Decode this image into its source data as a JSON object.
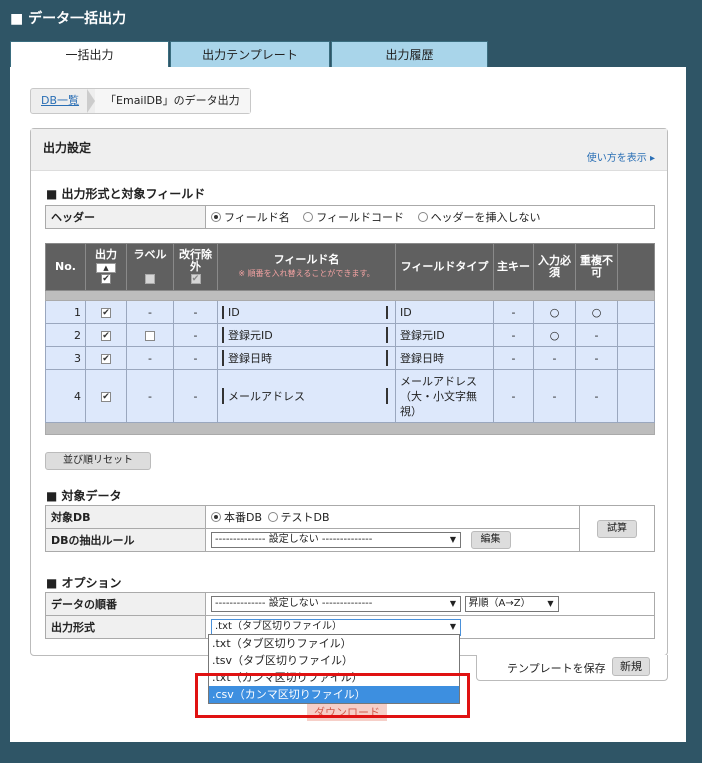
{
  "page_title": "■ データ一括出力",
  "tabs": [
    "一括出力",
    "出力テンプレート",
    "出力履歴"
  ],
  "breadcrumb": {
    "link": "DB一覧",
    "current": "「EmailDB」のデータ出力"
  },
  "panel": {
    "title": "出力設定",
    "help": "使い方を表示 ▸"
  },
  "section1": "■ 出力形式と対象フィールド",
  "header_row": {
    "label": "ヘッダー",
    "options": [
      "フィールド名",
      "フィールドコード",
      "ヘッダーを挿入しない"
    ],
    "selected": "フィールド名"
  },
  "field_table": {
    "headers": {
      "no": "No.",
      "output": "出力",
      "label": "ラベル",
      "newline": "改行除外",
      "field_name": "フィールド名",
      "field_name_note": "※ 順番を入れ替えることができます。",
      "field_type": "フィールドタイプ",
      "primary": "主キー",
      "required": "入力必須",
      "unique": "重複不可"
    },
    "rows": [
      {
        "no": "1",
        "label": "-",
        "newline": "-",
        "name": "ID",
        "type": "ID",
        "primary": "-",
        "required": "○",
        "unique": "○",
        "label_cb": false
      },
      {
        "no": "2",
        "label": "",
        "newline": "-",
        "name": "登録元ID",
        "type": "登録元ID",
        "primary": "-",
        "required": "○",
        "unique": "-",
        "label_cb": true
      },
      {
        "no": "3",
        "label": "-",
        "newline": "-",
        "name": "登録日時",
        "type": "登録日時",
        "primary": "-",
        "required": "-",
        "unique": "-",
        "label_cb": false
      },
      {
        "no": "4",
        "label": "-",
        "newline": "-",
        "name": "メールアドレス",
        "type": "メールアドレス（大・小文字無視）",
        "primary": "-",
        "required": "-",
        "unique": "-",
        "label_cb": false
      }
    ]
  },
  "reset_button": "並び順リセット",
  "section2": "■ 対象データ",
  "target": {
    "db_label": "対象DB",
    "db_options": [
      "本番DB",
      "テストDB"
    ],
    "db_selected": "本番DB",
    "rule_label": "DBの抽出ルール",
    "rule_value": "-------------- 設定しない --------------",
    "edit_button": "編集",
    "trial_button": "試算"
  },
  "section3": "■ オプション",
  "options": {
    "order_label": "データの順番",
    "order_value": "-------------- 設定しない --------------",
    "sort_value": "昇順（A→Z）",
    "format_label": "出力形式",
    "format_value": ".txt（タブ区切りファイル）"
  },
  "dropdown_items": [
    ".txt（タブ区切りファイル）",
    ".tsv（タブ区切りファイル）",
    ".txt（カンマ区切りファイル）",
    ".csv（カンマ区切りファイル）"
  ],
  "dropdown_selected_index": 3,
  "template": {
    "save_label": "テンプレートを保存",
    "new_button": "新規"
  },
  "download_button": "ダウンロード"
}
